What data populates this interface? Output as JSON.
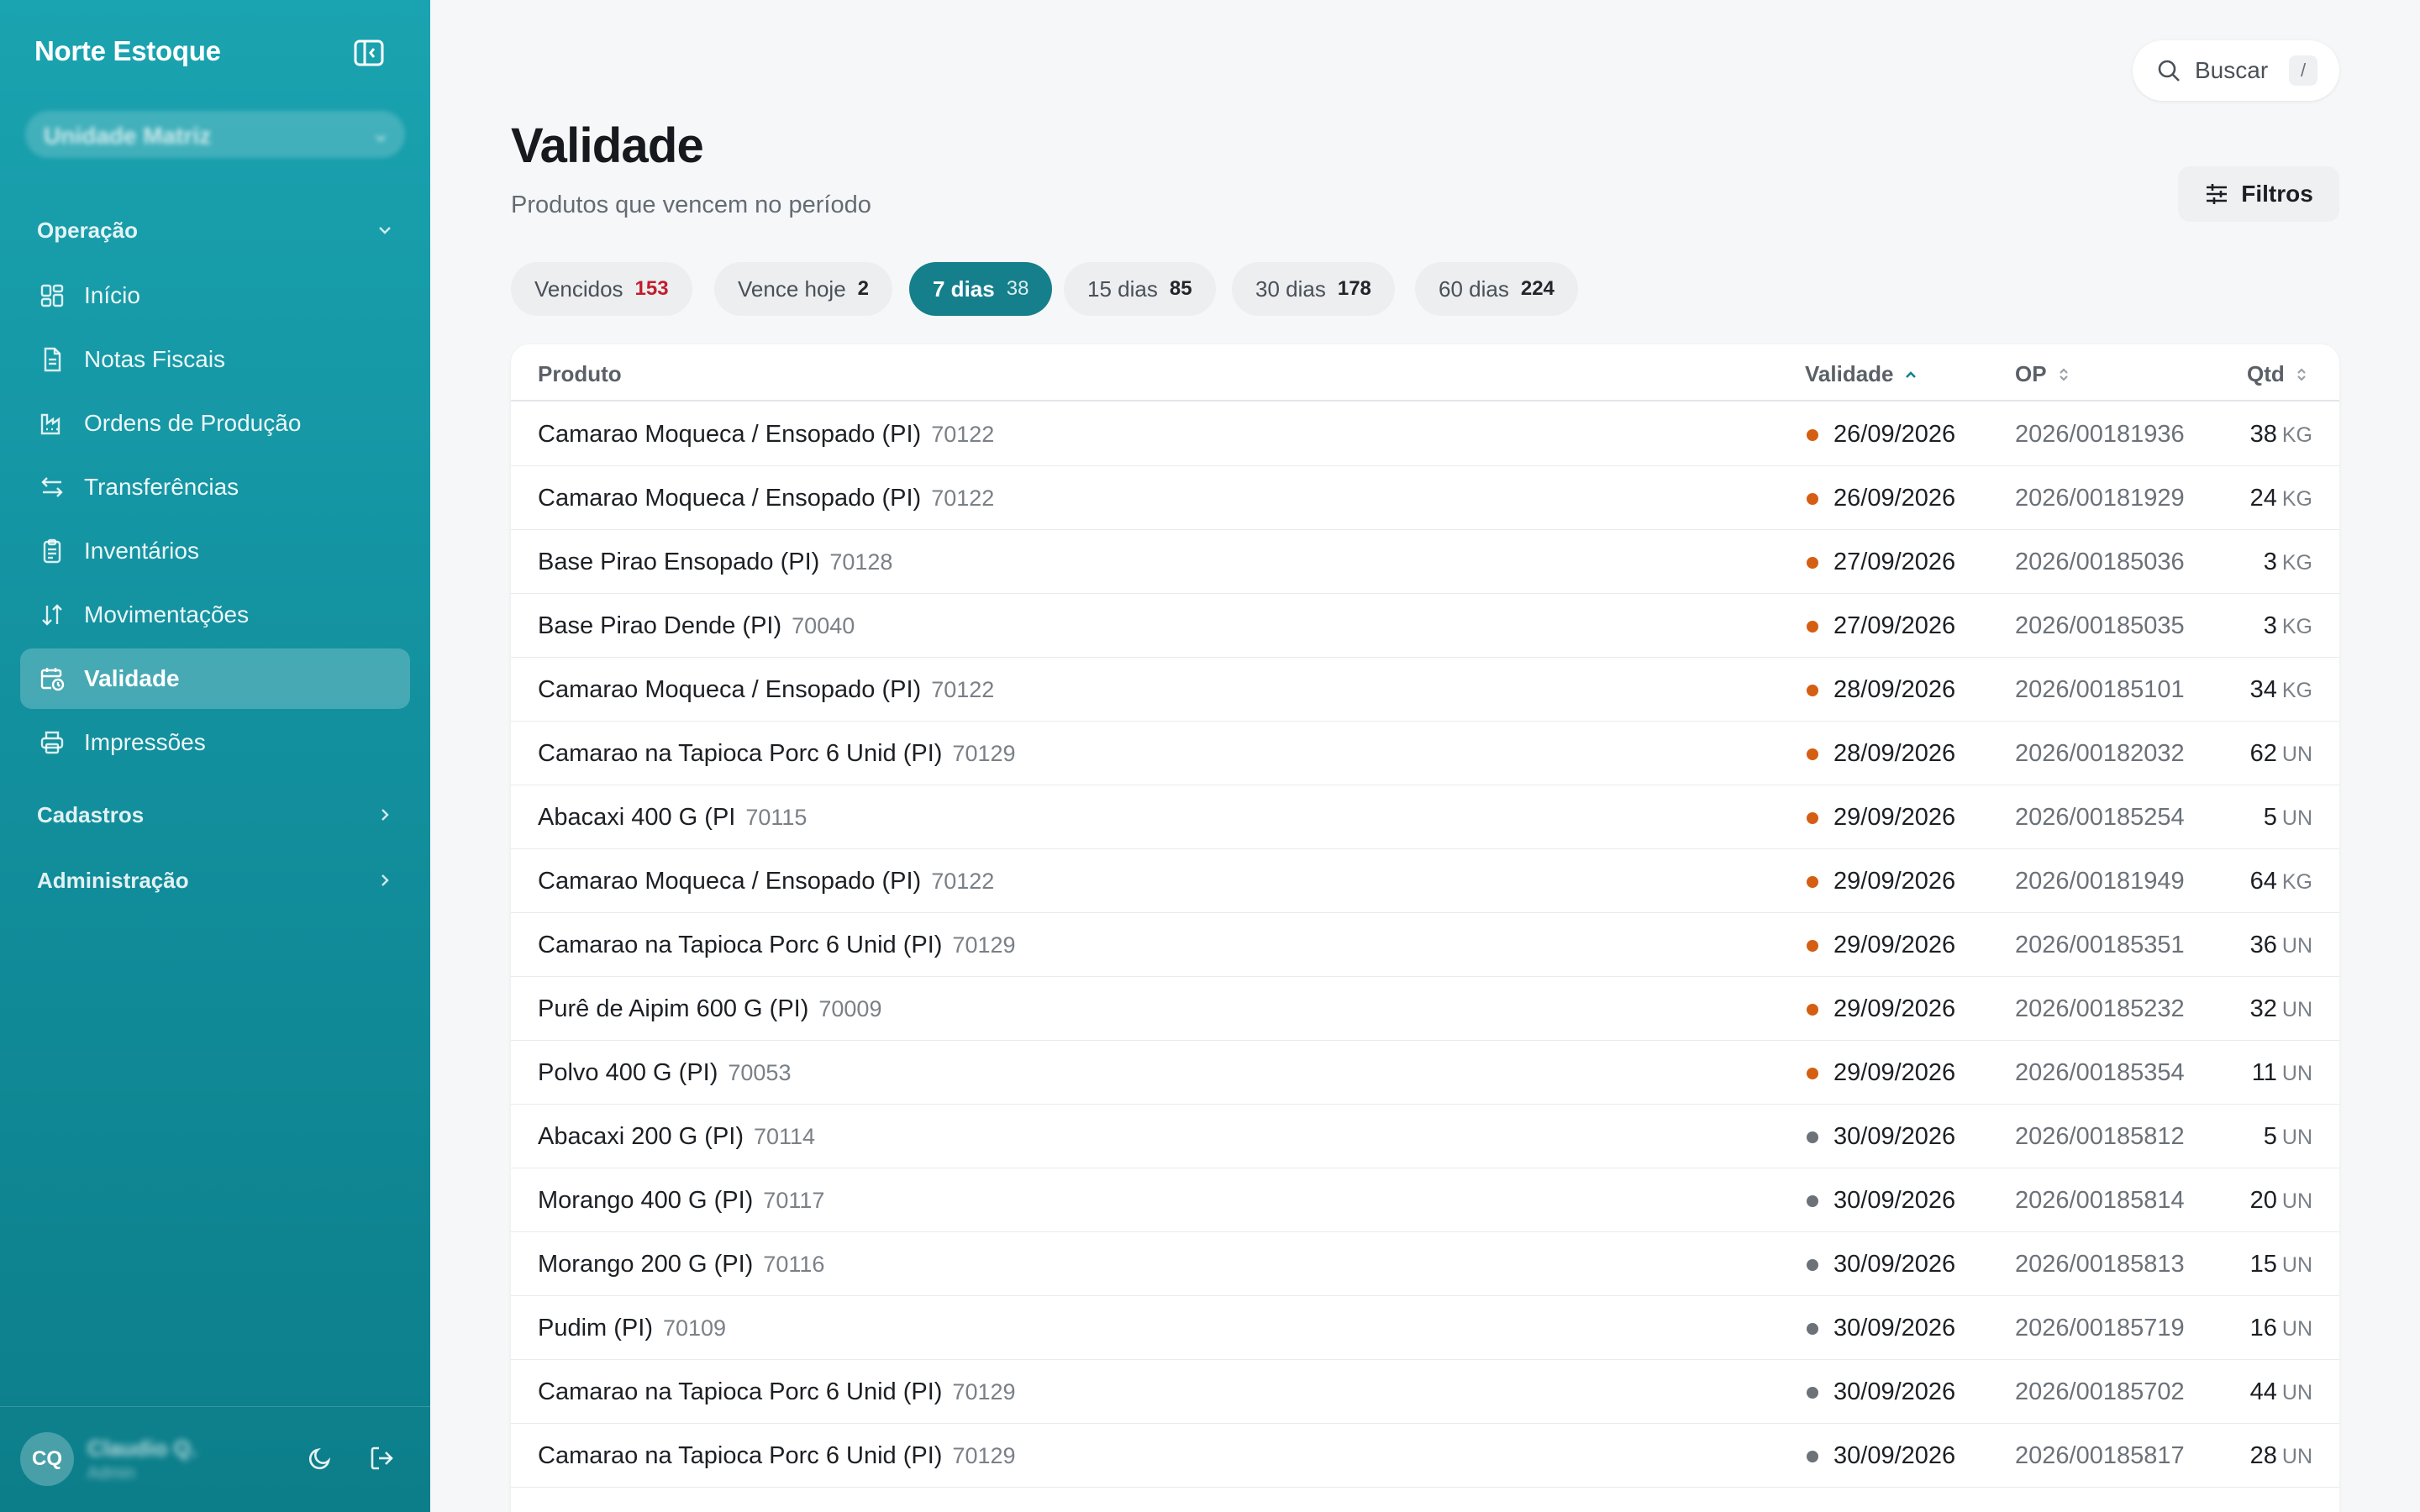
{
  "app": {
    "name": "Norte Estoque"
  },
  "tenant": {
    "label": "Unidade Matriz"
  },
  "search": {
    "label": "Buscar",
    "shortcut": "/"
  },
  "nav": {
    "operacao": "Operação",
    "items": [
      {
        "label": "Início",
        "icon": "grid-icon"
      },
      {
        "label": "Notas Fiscais",
        "icon": "document-icon"
      },
      {
        "label": "Ordens de Produção",
        "icon": "factory-icon"
      },
      {
        "label": "Transferências",
        "icon": "swap-icon"
      },
      {
        "label": "Inventários",
        "icon": "clipboard-icon"
      },
      {
        "label": "Movimentações",
        "icon": "arrows-updown-icon"
      },
      {
        "label": "Validade",
        "icon": "calendar-clock-icon"
      },
      {
        "label": "Impressões",
        "icon": "printer-icon"
      }
    ],
    "cadastros": "Cadastros",
    "administracao": "Administração"
  },
  "user": {
    "initials": "CQ",
    "name": "Claudio Q.",
    "role": "Admin"
  },
  "page": {
    "title": "Validade",
    "subtitle": "Produtos que vencem no período",
    "filters_label": "Filtros"
  },
  "tabs": [
    {
      "label": "Vencidos",
      "count": "153"
    },
    {
      "label": "Vence hoje",
      "count": "2"
    },
    {
      "label": "7 dias",
      "count": "38"
    },
    {
      "label": "15 dias",
      "count": "85"
    },
    {
      "label": "30 dias",
      "count": "178"
    },
    {
      "label": "60 dias",
      "count": "224"
    }
  ],
  "table": {
    "headers": {
      "produto": "Produto",
      "validade": "Validade",
      "op": "OP",
      "qtd": "Qtd"
    },
    "rows": [
      {
        "produto": "Camarao Moqueca / Ensopado (PI)",
        "codigo": "70122",
        "validade": "26/09/2026",
        "op": "2026/00181936",
        "qtd": "38",
        "unidade": "KG",
        "status": "orange"
      },
      {
        "produto": "Camarao Moqueca / Ensopado (PI)",
        "codigo": "70122",
        "validade": "26/09/2026",
        "op": "2026/00181929",
        "qtd": "24",
        "unidade": "KG",
        "status": "orange"
      },
      {
        "produto": "Base Pirao Ensopado (PI)",
        "codigo": "70128",
        "validade": "27/09/2026",
        "op": "2026/00185036",
        "qtd": "3",
        "unidade": "KG",
        "status": "orange"
      },
      {
        "produto": "Base Pirao Dende (PI)",
        "codigo": "70040",
        "validade": "27/09/2026",
        "op": "2026/00185035",
        "qtd": "3",
        "unidade": "KG",
        "status": "orange"
      },
      {
        "produto": "Camarao Moqueca / Ensopado (PI)",
        "codigo": "70122",
        "validade": "28/09/2026",
        "op": "2026/00185101",
        "qtd": "34",
        "unidade": "KG",
        "status": "orange"
      },
      {
        "produto": "Camarao na Tapioca Porc 6 Unid (PI)",
        "codigo": "70129",
        "validade": "28/09/2026",
        "op": "2026/00182032",
        "qtd": "62",
        "unidade": "UN",
        "status": "orange"
      },
      {
        "produto": "Abacaxi 400 G (PI",
        "codigo": "70115",
        "validade": "29/09/2026",
        "op": "2026/00185254",
        "qtd": "5",
        "unidade": "UN",
        "status": "orange"
      },
      {
        "produto": "Camarao Moqueca / Ensopado (PI)",
        "codigo": "70122",
        "validade": "29/09/2026",
        "op": "2026/00181949",
        "qtd": "64",
        "unidade": "KG",
        "status": "orange"
      },
      {
        "produto": "Camarao na Tapioca Porc 6 Unid (PI)",
        "codigo": "70129",
        "validade": "29/09/2026",
        "op": "2026/00185351",
        "qtd": "36",
        "unidade": "UN",
        "status": "orange"
      },
      {
        "produto": "Purê de Aipim 600 G (PI)",
        "codigo": "70009",
        "validade": "29/09/2026",
        "op": "2026/00185232",
        "qtd": "32",
        "unidade": "UN",
        "status": "orange"
      },
      {
        "produto": "Polvo 400 G (PI)",
        "codigo": "70053",
        "validade": "29/09/2026",
        "op": "2026/00185354",
        "qtd": "11",
        "unidade": "UN",
        "status": "orange"
      },
      {
        "produto": "Abacaxi 200 G (PI)",
        "codigo": "70114",
        "validade": "30/09/2026",
        "op": "2026/00185812",
        "qtd": "5",
        "unidade": "UN",
        "status": "gray"
      },
      {
        "produto": "Morango 400 G (PI)",
        "codigo": "70117",
        "validade": "30/09/2026",
        "op": "2026/00185814",
        "qtd": "20",
        "unidade": "UN",
        "status": "gray"
      },
      {
        "produto": "Morango 200 G (PI)",
        "codigo": "70116",
        "validade": "30/09/2026",
        "op": "2026/00185813",
        "qtd": "15",
        "unidade": "UN",
        "status": "gray"
      },
      {
        "produto": "Pudim (PI)",
        "codigo": "70109",
        "validade": "30/09/2026",
        "op": "2026/00185719",
        "qtd": "16",
        "unidade": "UN",
        "status": "gray"
      },
      {
        "produto": "Camarao na Tapioca Porc 6 Unid (PI)",
        "codigo": "70129",
        "validade": "30/09/2026",
        "op": "2026/00185702",
        "qtd": "44",
        "unidade": "UN",
        "status": "gray"
      },
      {
        "produto": "Camarao na Tapioca Porc 6 Unid (PI)",
        "codigo": "70129",
        "validade": "30/09/2026",
        "op": "2026/00185817",
        "qtd": "28",
        "unidade": "UN",
        "status": "gray"
      }
    ]
  },
  "colors": {
    "accent": "#15808c",
    "expiring": "#d45f12",
    "neutral": "#6d7278",
    "overdue": "#c21d2c"
  }
}
